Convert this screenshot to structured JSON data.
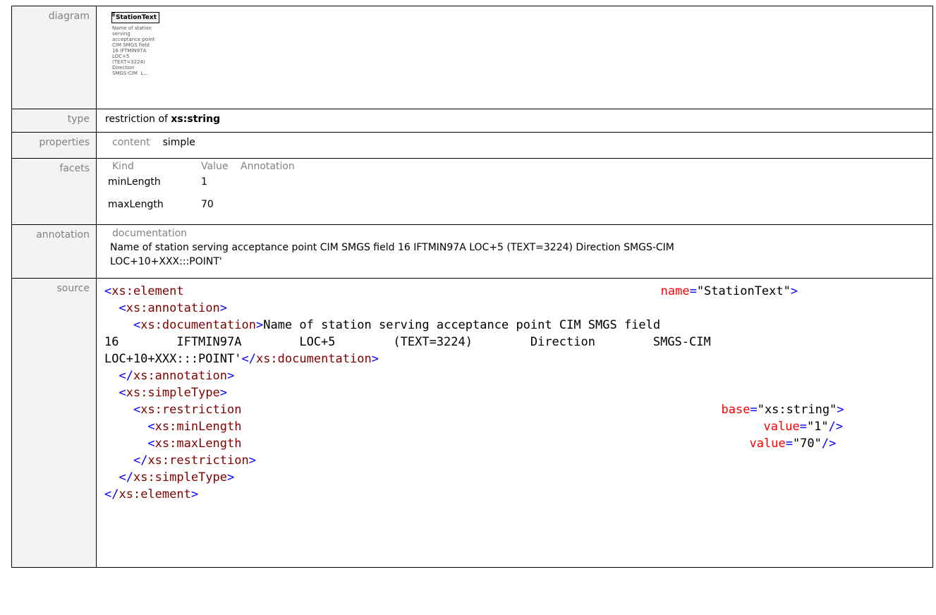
{
  "labels": {
    "diagram": "diagram",
    "type": "type",
    "properties": "properties",
    "facets": "facets",
    "annotation": "annotation",
    "source": "source"
  },
  "diagram": {
    "element_name": "StationText",
    "doc_lines": [
      "Name of station",
      "serving",
      "acceptance point",
      "CIM SMGS field",
      "16 IFTMIN97A",
      "LOC+5",
      "(TEXT=3224)",
      "Direction",
      "SMGS-CIM  L..."
    ]
  },
  "type": {
    "prefix": "restriction of ",
    "base": "xs:string"
  },
  "properties": {
    "key": "content",
    "value": "simple"
  },
  "facets": {
    "headers": [
      "Kind",
      "Value",
      "Annotation"
    ],
    "rows": [
      {
        "kind": "minLength",
        "value": "1"
      },
      {
        "kind": "maxLength",
        "value": "70"
      }
    ]
  },
  "annotation": {
    "heading": "documentation",
    "line1": "Name of station serving acceptance point CIM SMGS field 16 IFTMIN97A LOC+5 (TEXT=3224) Direction SMGS-CIM",
    "line2": "LOC+10+XXX:::POINT'"
  },
  "source": {
    "element_open": "xs:element",
    "name_attr": "name",
    "name_value": "\"StationText\"",
    "annotation_tag": "xs:annotation",
    "documentation_tag": "xs:documentation",
    "doc_text_line1": "Name of station serving acceptance point CIM SMGS field",
    "doc_text_line2": "16        IFTMIN97A        LOC+5        (TEXT=3224)        Direction        SMGS-CIM",
    "doc_text_line3": "LOC+10+XXX:::POINT'",
    "simpletype_tag": "xs:simpleType",
    "restriction_tag": "xs:restriction",
    "base_attr": "base",
    "base_value": "\"xs:string\"",
    "minlength_tag": "xs:minLength",
    "maxlength_tag": "xs:maxLength",
    "value_attr": "value",
    "min_value": "\"1\"",
    "max_value": "\"70\""
  }
}
